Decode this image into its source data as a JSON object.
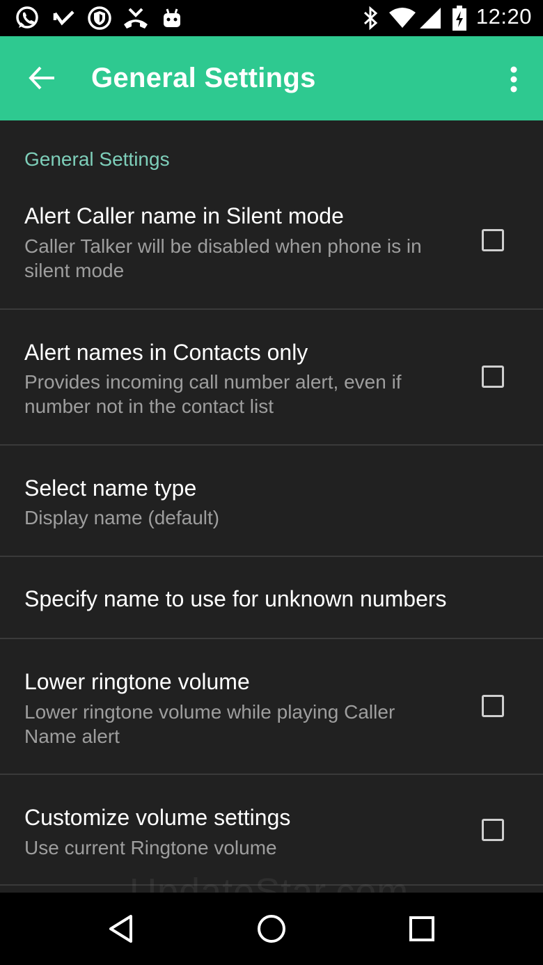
{
  "status_bar": {
    "time": "12:20",
    "left_icons": [
      "whatsapp-icon",
      "missed-call-icon",
      "vpn-shield-icon",
      "call-end-icon",
      "android-icon"
    ],
    "right_icons": [
      "bluetooth-icon",
      "wifi-icon",
      "signal-icon",
      "battery-icon"
    ]
  },
  "app_bar": {
    "title": "General Settings",
    "background": "#2ec990"
  },
  "category": {
    "label": "General Settings",
    "color": "#7ecfba"
  },
  "preferences": [
    {
      "title": "Alert Caller name in Silent mode",
      "summary": "Caller Talker will be disabled when phone is in silent mode",
      "checked": false
    },
    {
      "title": "Alert names in Contacts only",
      "summary": "Provides incoming call number alert, even if number not in the contact list",
      "checked": false
    },
    {
      "title": "Select name type",
      "summary": "Display name (default)"
    },
    {
      "title": "Specify name to use for unknown numbers"
    },
    {
      "title": "Lower ringtone volume",
      "summary": "Lower ringtone volume while playing Caller Name alert",
      "checked": false
    },
    {
      "title": "Customize volume settings",
      "summary": "Use current Ringtone volume",
      "checked": false
    }
  ],
  "watermark": "UpdateStar.com",
  "nav_bar": [
    "back-icon",
    "home-icon",
    "recents-icon"
  ]
}
